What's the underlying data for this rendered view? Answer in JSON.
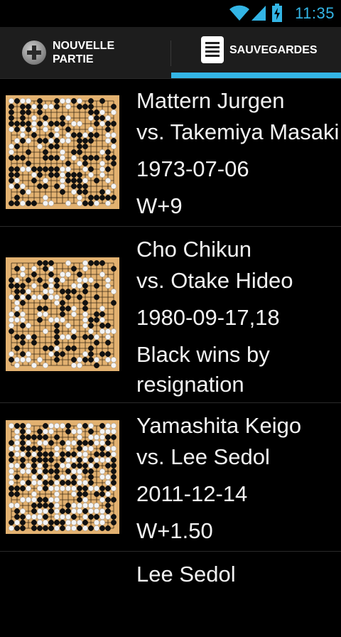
{
  "status_bar": {
    "time": "11:35"
  },
  "tabs": [
    {
      "label_line1": "NOUVELLE",
      "label_line2": "PARTIE",
      "icon": "plus-circle-icon"
    },
    {
      "label": "SAUVEGARDES",
      "icon": "document-list-icon",
      "selected": true
    }
  ],
  "games": [
    {
      "player1": "Mattern Jurgen",
      "player2": "vs.  Takemiya Masaki",
      "date": "1973-07-06",
      "result": "W+9",
      "result_line2": ""
    },
    {
      "player1": "Cho Chikun",
      "player2": "vs.  Otake Hideo",
      "date": "1980-09-17,18",
      "result": "Black wins by",
      "result_line2": "resignation"
    },
    {
      "player1": "Yamashita Keigo",
      "player2": "vs.  Lee Sedol",
      "date": "2011-12-14",
      "result": "W+1.50",
      "result_line2": ""
    },
    {
      "player1": "Lee Sedol",
      "player2": "",
      "date": "",
      "result": "",
      "result_line2": ""
    }
  ],
  "colors": {
    "accent": "#33b5e5",
    "board": "#e2b170"
  }
}
